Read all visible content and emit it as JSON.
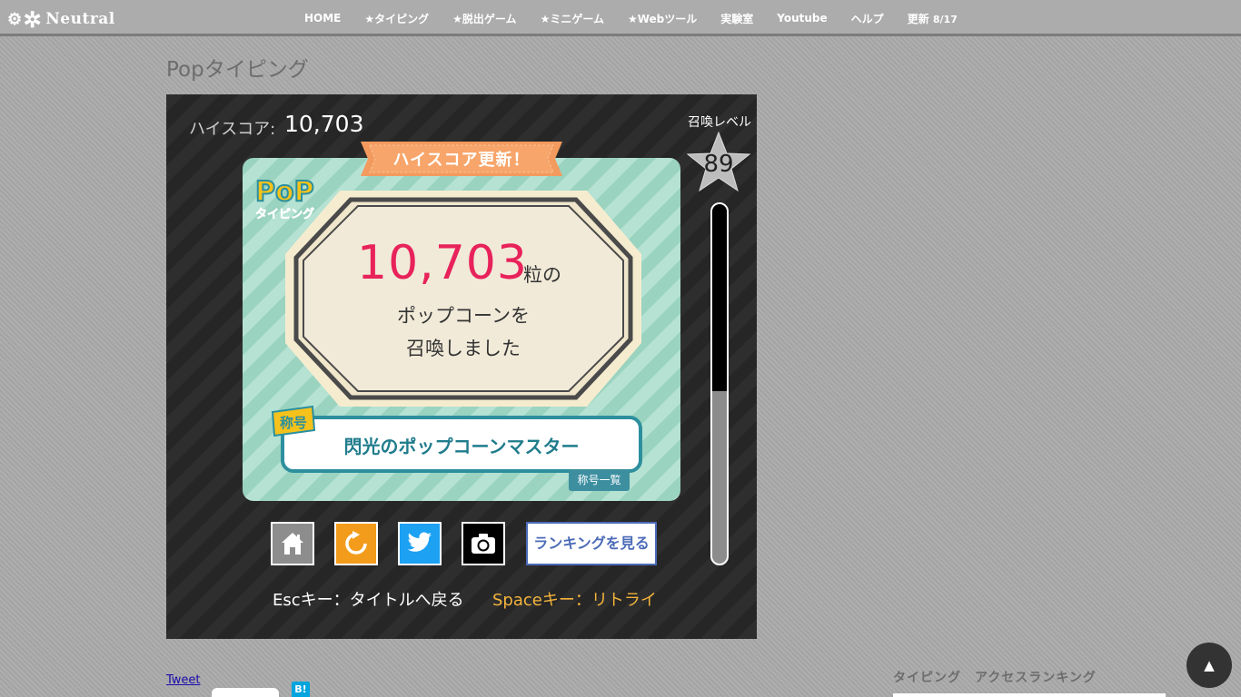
{
  "nav": {
    "logo_text": "Neutral",
    "items": [
      "HOME",
      "★タイピング",
      "★脱出ゲーム",
      "★ミニゲーム",
      "★Webツール",
      "実験室",
      "Youtube",
      "ヘルプ"
    ],
    "update_label": "更新",
    "update_date": "8/17"
  },
  "page_title": "Popタイピング",
  "game": {
    "hiscore_label": "ハイスコア:",
    "hiscore_value": "10,703",
    "level_label": "召喚レベル",
    "level_value": "89",
    "gauge_fill_fraction": 0.52,
    "ribbon_text": "ハイスコア更新！",
    "score_value": "10,703",
    "score_unit": "粒の",
    "score_line1": "ポップコーンを",
    "score_line2": "召喚しました",
    "title_tag": "称号",
    "title_text": "閃光のポップコーンマスター",
    "title_list_label": "称号一覧",
    "ranking_button": "ランキングを見る",
    "hint_esc": "Escキー：タイトルへ戻る",
    "hint_space": "Spaceキー：リトライ",
    "logo_pop": "PoP",
    "logo_sub": "タイピング"
  },
  "footer": {
    "tweet": "Tweet",
    "hatena": "B!",
    "ranking_heading": "タイピング　アクセスランキング",
    "to_top": "▲"
  },
  "colors": {
    "accent_pink": "#e8225a",
    "title_teal": "#1f7c8c",
    "space_hint": "#f5b43c"
  }
}
